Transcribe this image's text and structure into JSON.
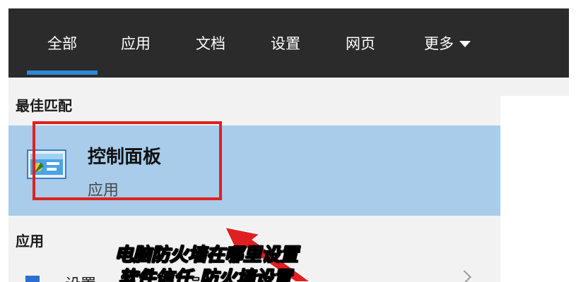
{
  "tabs": [
    {
      "label": "全部",
      "active": true
    },
    {
      "label": "应用"
    },
    {
      "label": "文档"
    },
    {
      "label": "设置"
    },
    {
      "label": "网页"
    },
    {
      "label": "更多"
    }
  ],
  "sections": {
    "best_match": "最佳匹配",
    "apps": "应用"
  },
  "best_match_item": {
    "title": "控制面板",
    "subtitle": "应用",
    "icon": "control-panel-icon"
  },
  "apps_items": [
    {
      "label": "设置",
      "icon": "settings-icon"
    }
  ],
  "overlay": {
    "caption_line1": "电脑防火墙在哪里设置",
    "caption_line2": "软件信任-防火墙设置"
  },
  "colors": {
    "tabbar_bg": "#2b2b2b",
    "accent": "#2d89d9",
    "selected_row": "#a8cce9",
    "highlight_box": "#e02020"
  }
}
